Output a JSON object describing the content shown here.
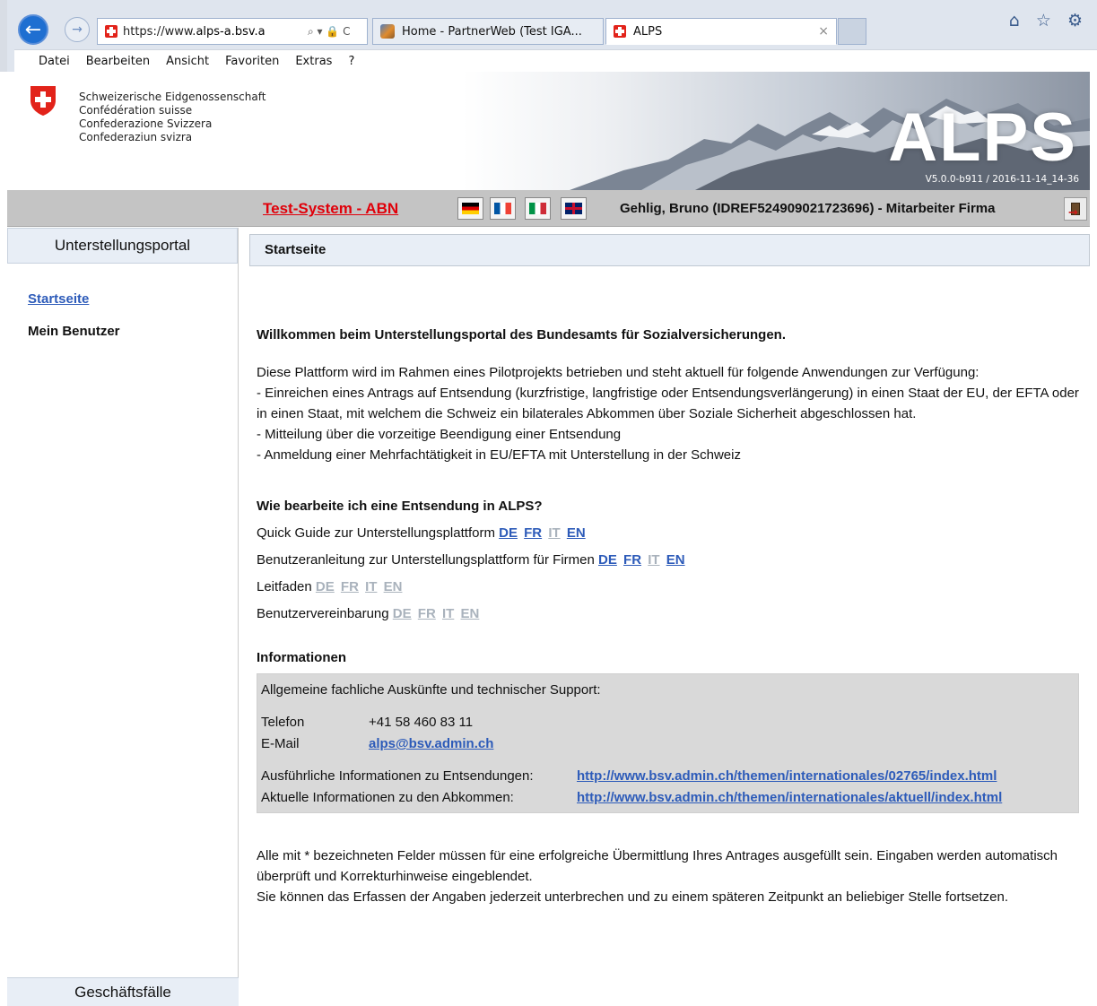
{
  "browser": {
    "url_prefix": "https://www.",
    "url_host": "alps-a.bsv.a",
    "addr_controls": "⌕ ▾ 🔒 C",
    "tabs": [
      {
        "title": "Home - PartnerWeb (Test IGA...",
        "active": false
      },
      {
        "title": "ALPS",
        "active": true,
        "close": "×"
      }
    ],
    "toolbar_icons": "⌂ ☆ ⚙",
    "menu": [
      "Datei",
      "Bearbeiten",
      "Ansicht",
      "Favoriten",
      "Extras",
      "?"
    ]
  },
  "banner": {
    "confederation_lines": [
      "Schweizerische Eidgenossenschaft",
      "Confédération suisse",
      "Confederazione Svizzera",
      "Confederaziun svizra"
    ],
    "app_name": "ALPS",
    "version": "V5.0.0-b911 / 2016-11-14_14-36"
  },
  "topbar": {
    "system_label": "Test-System - ABN",
    "languages": [
      "DE",
      "FR",
      "IT",
      "EN"
    ],
    "user": "Gehlig, Bruno (IDREF524909021723696) - Mitarbeiter Firma"
  },
  "sidebar": {
    "header": "Unterstellungsportal",
    "items": [
      {
        "label": "Startseite",
        "active": true
      },
      {
        "label": "Mein Benutzer",
        "active": false
      }
    ],
    "footer": "Geschäftsfälle"
  },
  "main": {
    "breadcrumb": "Startseite",
    "welcome": "Willkommen beim Unterstellungsportal des Bundesamts für Sozialversicherungen.",
    "intro": "Diese Plattform wird im Rahmen eines Pilotprojekts betrieben und steht aktuell für folgende Anwendungen zur Verfügung:",
    "intro_items": [
      "- Einreichen eines Antrags auf Entsendung (kurzfristige, langfristige oder Entsendungsverlängerung) in einen Staat der EU, der EFTA oder in einen Staat, mit welchem die Schweiz ein bilaterales Abkommen über Soziale  Sicherheit abgeschlossen hat.",
      "- Mitteilung über die vorzeitige Beendigung einer Entsendung",
      "- Anmeldung einer Mehrfachtätigkeit in EU/EFTA mit Unterstellung in der Schweiz"
    ],
    "howto_title": "Wie bearbeite ich eine Entsendung in ALPS?",
    "documents": [
      {
        "label": "Quick Guide zur Unterstellungsplattform",
        "langs": [
          {
            "code": "DE",
            "enabled": true
          },
          {
            "code": "FR",
            "enabled": true
          },
          {
            "code": "IT",
            "enabled": false
          },
          {
            "code": "EN",
            "enabled": true
          }
        ]
      },
      {
        "label": "Benutzeranleitung zur Unterstellungsplattform für Firmen",
        "langs": [
          {
            "code": "DE",
            "enabled": true
          },
          {
            "code": "FR",
            "enabled": true
          },
          {
            "code": "IT",
            "enabled": false
          },
          {
            "code": "EN",
            "enabled": true
          }
        ]
      },
      {
        "label": "Leitfaden",
        "langs": [
          {
            "code": "DE",
            "enabled": false
          },
          {
            "code": "FR",
            "enabled": false
          },
          {
            "code": "IT",
            "enabled": false
          },
          {
            "code": "EN",
            "enabled": false
          }
        ]
      },
      {
        "label": "Benutzervereinbarung",
        "langs": [
          {
            "code": "DE",
            "enabled": false
          },
          {
            "code": "FR",
            "enabled": false
          },
          {
            "code": "IT",
            "enabled": false
          },
          {
            "code": "EN",
            "enabled": false
          }
        ]
      }
    ],
    "info_title": "Informationen",
    "support_line": "Allgemeine fachliche Auskünfte und technischer Support:",
    "phone_label": "Telefon",
    "phone": "+41 58 460 83 11",
    "email_label": "E-Mail",
    "email": "alps@bsv.admin.ch",
    "detail_label": "Ausführliche Informationen zu Entsendungen:",
    "detail_url": "http://www.bsv.admin.ch/themen/internationales/02765/index.html",
    "current_label": "Aktuelle Informationen zu den Abkommen:",
    "current_url": "http://www.bsv.admin.ch/themen/internationales/aktuell/index.html",
    "footer_note_1": "Alle mit * bezeichneten Felder müssen für eine erfolgreiche Übermittlung Ihres Antrages ausgefüllt sein. Eingaben werden automatisch überprüft und Korrekturhinweise eingeblendet.",
    "footer_note_2": "Sie können das Erfassen der Angaben jederzeit unterbrechen und zu einem späteren Zeitpunkt an beliebiger Stelle fortsetzen."
  }
}
